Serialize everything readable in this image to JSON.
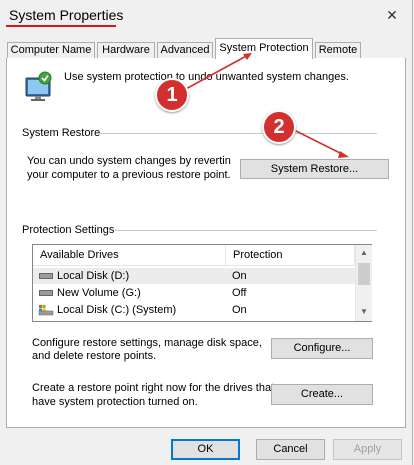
{
  "window": {
    "title": "System Properties",
    "close_glyph": "✕"
  },
  "tabs": [
    {
      "label": "Computer Name"
    },
    {
      "label": "Hardware"
    },
    {
      "label": "Advanced"
    },
    {
      "label": "System Protection"
    },
    {
      "label": "Remote"
    }
  ],
  "active_tab": "System Protection",
  "intro": {
    "text": "Use system protection to undo unwanted system changes.",
    "icon": "computer-shield-icon"
  },
  "system_restore": {
    "group_label": "System Restore",
    "line1": "You can undo system changes by revertin",
    "line2": "your computer to a previous restore point.",
    "button_label": "System Restore..."
  },
  "protection_settings": {
    "group_label": "Protection Settings",
    "columns": [
      "Available Drives",
      "Protection"
    ],
    "drives": [
      {
        "name": "Local Disk (D:)",
        "protection": "On",
        "icon": "drive-icon"
      },
      {
        "name": "New Volume (G:)",
        "protection": "Off",
        "icon": "drive-icon"
      },
      {
        "name": "Local Disk (C:) (System)",
        "protection": "On",
        "icon": "system-drive-icon"
      }
    ],
    "configure_text1": "Configure restore settings, manage disk space,",
    "configure_text2": "and delete restore points.",
    "configure_label": "Configure...",
    "create_text1": "Create a restore point right now for the drives that",
    "create_text2": "have system protection turned on.",
    "create_label": "Create..."
  },
  "footer": {
    "ok": "OK",
    "cancel": "Cancel",
    "apply": "Apply"
  },
  "annotations": [
    {
      "number": "1"
    },
    {
      "number": "2"
    }
  ],
  "colors": {
    "accent": "#0078d7",
    "marker": "#d32f2f"
  }
}
